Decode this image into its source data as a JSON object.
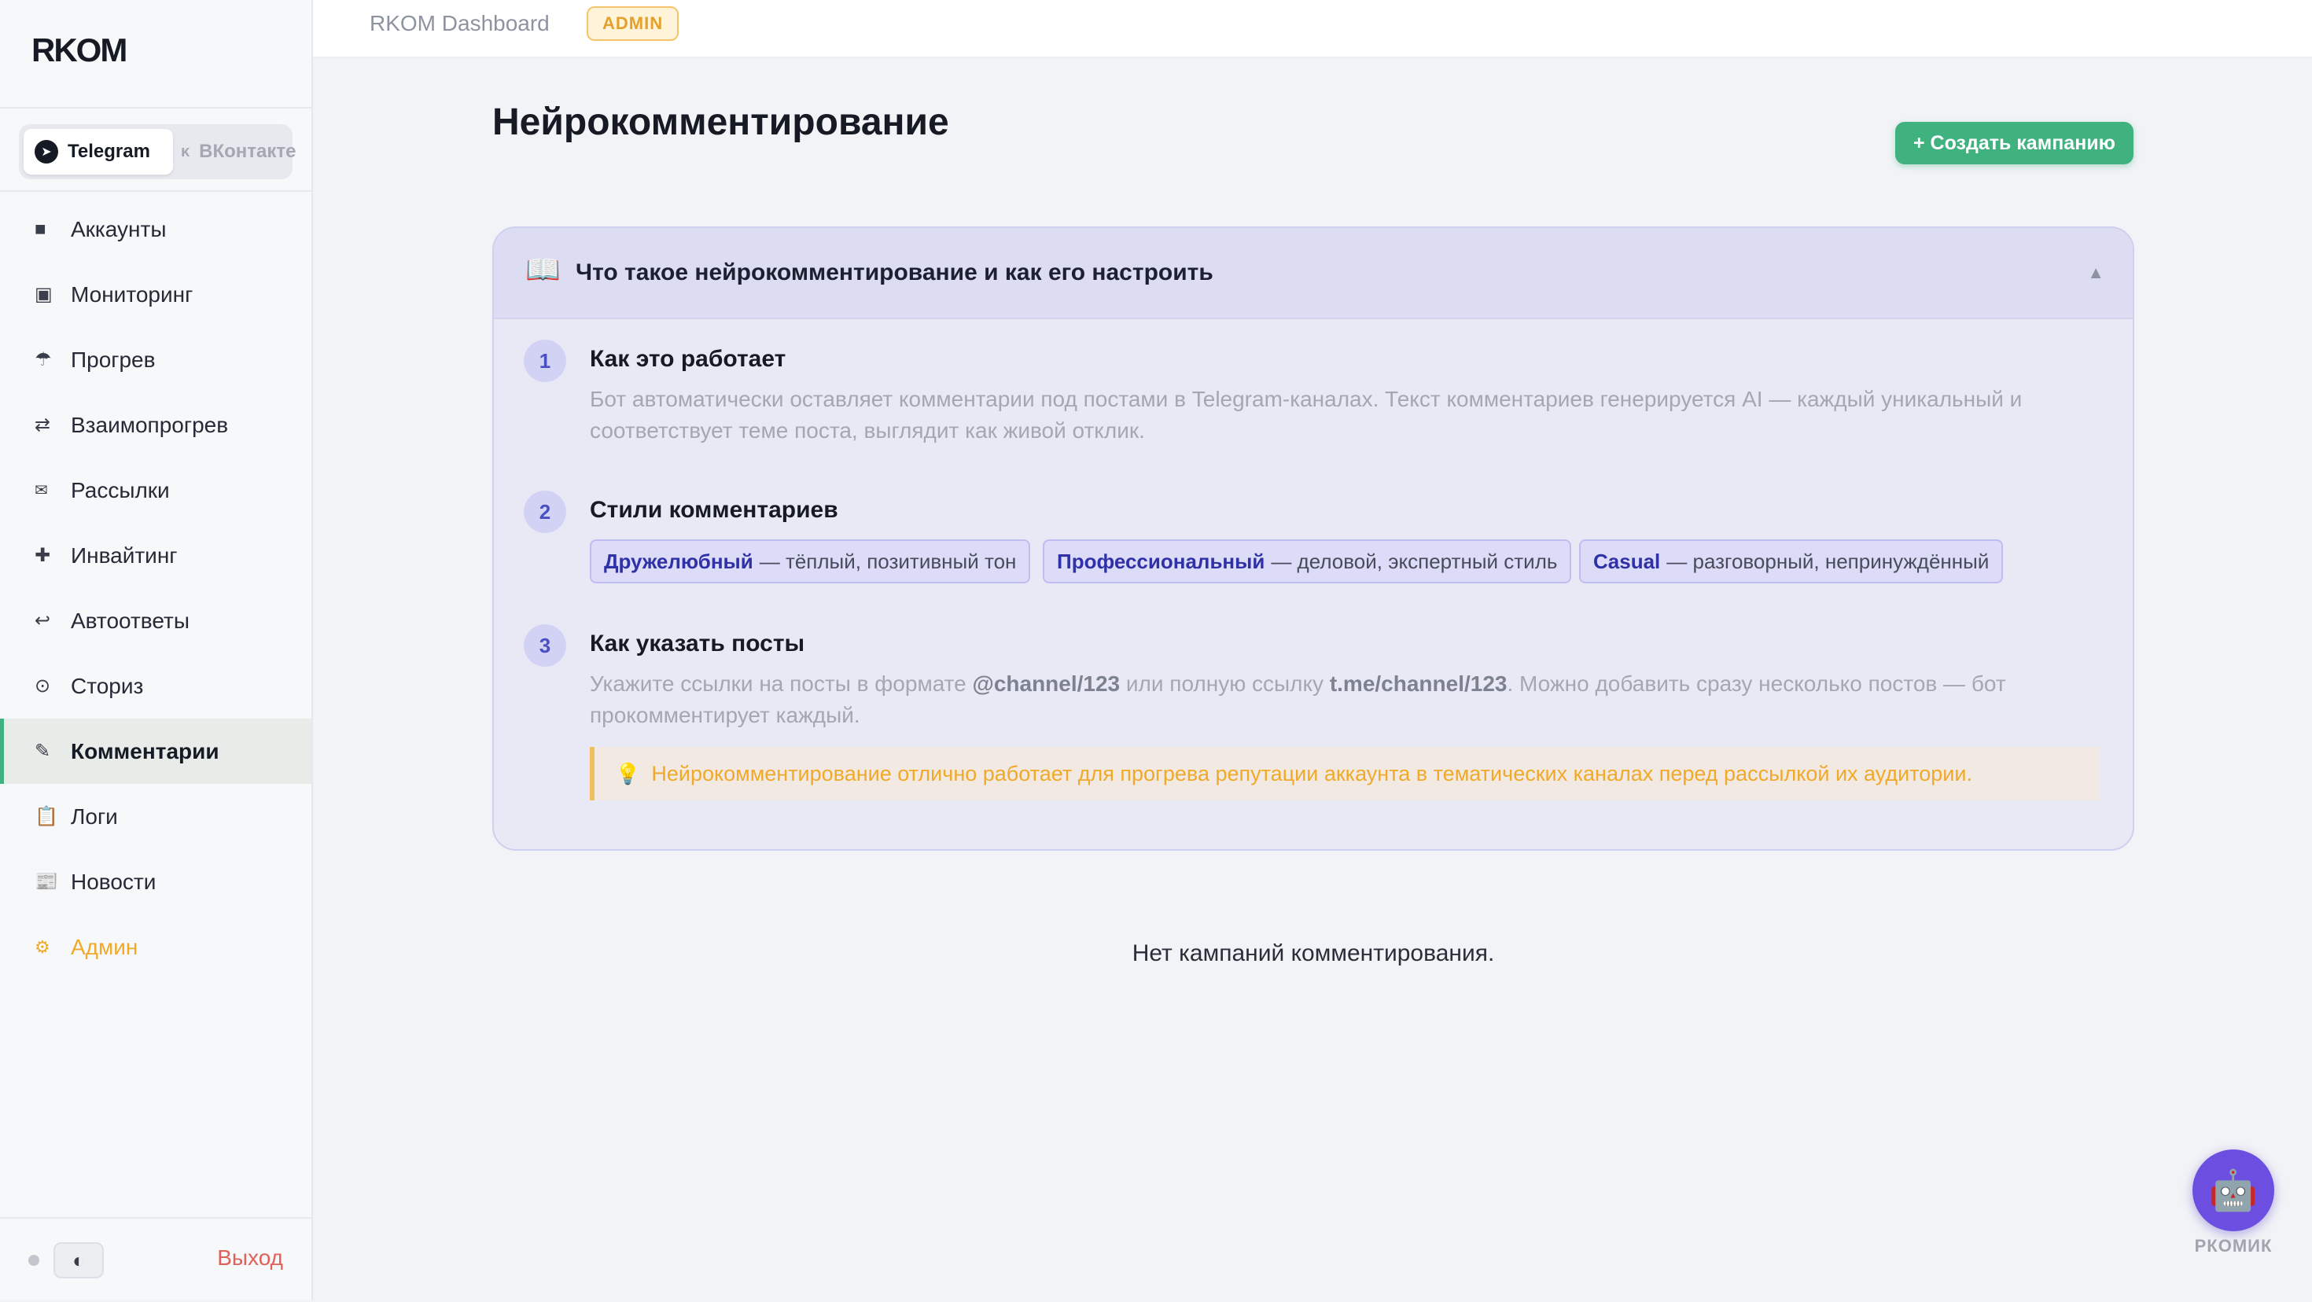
{
  "app": {
    "logo": "RKOM"
  },
  "topbar": {
    "title": "RKOM Dashboard",
    "badge": "ADMIN"
  },
  "platforms": [
    {
      "label": "Telegram",
      "icon": "telegram-icon",
      "active": true
    },
    {
      "label": "ВКонтакте",
      "icon": "vk-icon",
      "active": false
    }
  ],
  "nav": [
    {
      "label": "Аккаунты",
      "icon": "square-icon",
      "glyph": "■"
    },
    {
      "label": "Мониторинг",
      "icon": "monitor-icon",
      "glyph": "▣"
    },
    {
      "label": "Прогрев",
      "icon": "umbrella-icon",
      "glyph": "☂"
    },
    {
      "label": "Взаимопрогрев",
      "icon": "swap-arrows-icon",
      "glyph": "⇄"
    },
    {
      "label": "Рассылки",
      "icon": "envelope-icon",
      "glyph": "✉"
    },
    {
      "label": "Инвайтинг",
      "icon": "plus-icon",
      "glyph": "✚"
    },
    {
      "label": "Автоответы",
      "icon": "reply-arrow-icon",
      "glyph": "↩"
    },
    {
      "label": "Сториз",
      "icon": "circle-dot-icon",
      "glyph": "⊙"
    },
    {
      "label": "Комментарии",
      "icon": "pencil-icon",
      "glyph": "✎",
      "active": true
    },
    {
      "label": "Логи",
      "icon": "clipboard-icon",
      "glyph": "📋"
    },
    {
      "label": "Новости",
      "icon": "newspaper-icon",
      "glyph": "📰"
    },
    {
      "label": "Админ",
      "icon": "gear-icon",
      "glyph": "⚙",
      "admin": true
    }
  ],
  "footer": {
    "theme_glyph": "◐",
    "logout": "Выход"
  },
  "page": {
    "title": "Нейрокомментирование",
    "create_button": "+ Создать кампанию"
  },
  "guide": {
    "icon": "📖",
    "title": "Что такое нейрокомментирование и как его настроить",
    "caret": "▲",
    "steps": [
      {
        "num": "1",
        "title": "Как это работает",
        "text": "Бот автоматически оставляет комментарии под постами в Telegram-каналах. Текст комментариев генерируется AI — каждый уникальный и соответствует теме поста, выглядит как живой отклик."
      },
      {
        "num": "2",
        "title": "Стили комментариев",
        "chips": [
          {
            "name": "Дружелюбный",
            "desc": "— тёплый, позитивный тон"
          },
          {
            "name": "Профессиональный",
            "desc": "— деловой, экспертный стиль"
          },
          {
            "name": "Casual",
            "desc": "— разговорный, непринуждённый"
          }
        ]
      },
      {
        "num": "3",
        "title": "Как указать посты",
        "text_parts": {
          "a": "Укажите ссылки на посты в формате ",
          "b": "@channel/123",
          "c": " или полную ссылку ",
          "d": "t.me/channel/123",
          "e": ". Можно добавить сразу несколько постов — бот прокомментирует каждый."
        },
        "tip_icon": "💡",
        "tip": "Нейрокомментирование отлично работает для прогрева репутации аккаунта в тематических каналах перед рассылкой их аудитории."
      }
    ]
  },
  "empty_state": "Нет кампаний комментирования.",
  "assistant": {
    "glyph": "🤖",
    "label": "РКОМИК"
  },
  "colors": {
    "accent_green": "#3fb27f",
    "admin_orange": "#f0a928",
    "logout_red": "#e0605a",
    "bot_purple": "#6c4ee0"
  }
}
